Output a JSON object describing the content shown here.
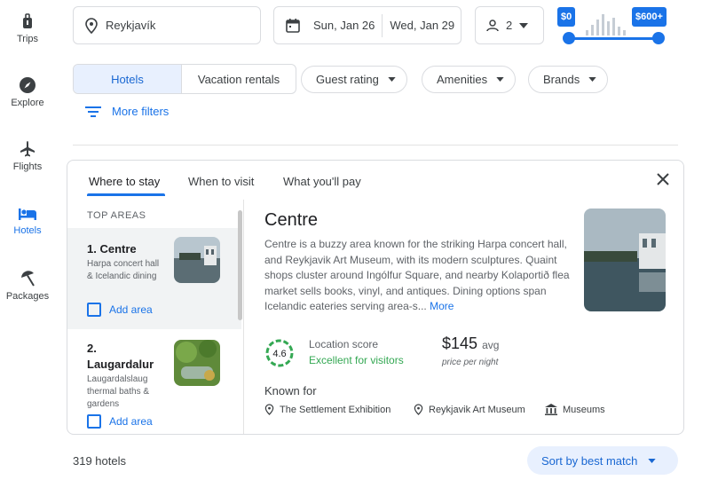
{
  "nav": {
    "items": [
      {
        "label": "Trips",
        "icon": "suitcase-icon"
      },
      {
        "label": "Explore",
        "icon": "compass-icon"
      },
      {
        "label": "Flights",
        "icon": "airplane-icon"
      },
      {
        "label": "Hotels",
        "icon": "bed-icon"
      },
      {
        "label": "Packages",
        "icon": "beach-umbrella-icon"
      }
    ],
    "active": "Hotels"
  },
  "search": {
    "location": "Reykjavík",
    "check_in": "Sun, Jan 26",
    "check_out": "Wed, Jan 29",
    "guests": "2"
  },
  "price_filter": {
    "min_label": "$0",
    "max_label": "$600+"
  },
  "filters": {
    "segment_selected": "Hotels",
    "segment_other": "Vacation rentals",
    "chips": [
      "Guest rating",
      "Amenities",
      "Brands"
    ],
    "more_filters": "More filters"
  },
  "panel": {
    "tabs": [
      "Where to stay",
      "When to visit",
      "What you'll pay"
    ],
    "active_tab": "Where to stay",
    "top_areas_title": "TOP AREAS",
    "areas": [
      {
        "name": "1. Centre",
        "desc": "Harpa concert hall & Icelandic dining",
        "add_label": "Add area"
      },
      {
        "name_line1": "2.",
        "name_line2": "Laugardalur",
        "desc": "Laugardalslaug thermal baths & gardens",
        "add_label": "Add area"
      }
    ],
    "detail": {
      "title": "Centre",
      "description": "Centre is a buzzy area known for the striking Harpa concert hall, and Reykjavik Art Museum, with its modern sculptures. Quaint shops cluster around Ingólfur Square, and nearby Kolaportið flea market sells books, vinyl, and antiques. Dining options span Icelandic eateries serving area-s...",
      "more_label": "More",
      "score": "4.6",
      "score_label": "Location score",
      "score_sub": "Excellent for visitors",
      "price": "$145",
      "price_unit": "avg",
      "price_note": "price per night",
      "known_for_title": "Known for",
      "known_for": [
        "The Settlement Exhibition",
        "Reykjavik Art Museum",
        "Museums"
      ]
    }
  },
  "results": {
    "count": "319 hotels",
    "sort_label": "Sort by best match"
  },
  "colors": {
    "accent": "#1a73e8",
    "score_green": "#34a853",
    "selected_bg": "#e8f0fe"
  }
}
